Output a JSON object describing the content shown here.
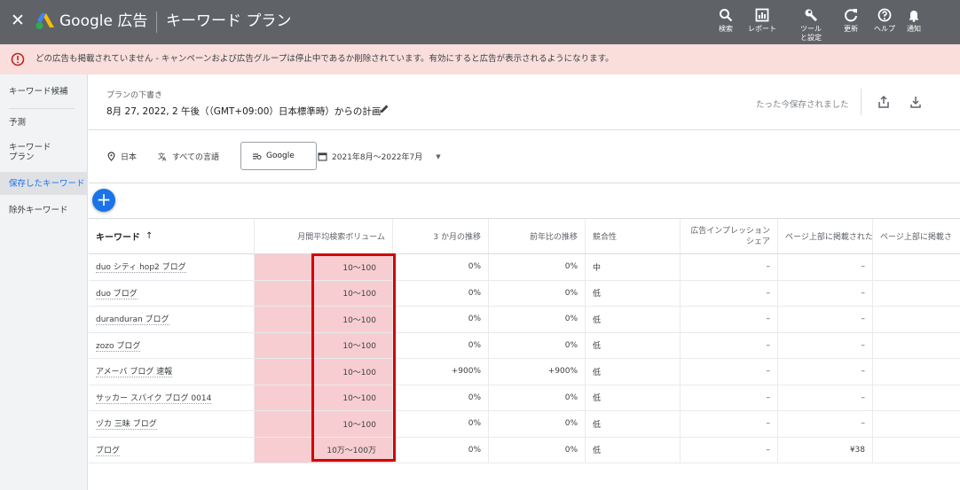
{
  "topbar": {
    "brand": "Google 広告",
    "title": "キーワード プラン",
    "items": [
      {
        "label": "検索",
        "icon": "search-icon"
      },
      {
        "label": "レポート",
        "icon": "report-icon"
      },
      {
        "label": "ツールと設定",
        "icon": "wrench-icon"
      },
      {
        "label": "更新",
        "icon": "refresh-icon"
      },
      {
        "label": "ヘルプ",
        "icon": "help-icon"
      },
      {
        "label": "通知",
        "icon": "bell-icon"
      }
    ]
  },
  "alert": {
    "text": "どの広告も掲載されていません - キャンペーンおよび広告グループは停止中であるか削除されています。有効にすると広告が表示されるようになります。"
  },
  "sidebar": {
    "items": [
      {
        "label": "キーワード候補"
      },
      {
        "label": "予測"
      },
      {
        "label": "キーワード\nプラン"
      },
      {
        "label": "保存したキーワード"
      },
      {
        "label": "除外キーワード"
      }
    ],
    "active_index": 3
  },
  "plan": {
    "label": "プランの下書き",
    "title": "8月 27, 2022, 2 午後（（GMT+09:00）日本標準時）からの計画",
    "saved": "たった今保存されました"
  },
  "filters": {
    "location": "日本",
    "language": "すべての言語",
    "network": "Google",
    "date_range": "2021年8月～2022年7月"
  },
  "table": {
    "columns": [
      "キーワード",
      "月間平均検索ボリューム",
      "3 か月の推移",
      "前年比の推移",
      "競合性",
      "広告インプレッション シェア",
      "ページ上部に掲載された",
      "ページ上部に掲載さ"
    ],
    "rows": [
      [
        "duo シティ hop2 ブログ",
        "10～100",
        "0%",
        "0%",
        "中",
        "–",
        "–",
        ""
      ],
      [
        "duo ブログ",
        "10～100",
        "0%",
        "0%",
        "低",
        "–",
        "–",
        ""
      ],
      [
        "duranduran ブログ",
        "10～100",
        "0%",
        "0%",
        "低",
        "–",
        "–",
        ""
      ],
      [
        "zozo ブログ",
        "10～100",
        "0%",
        "0%",
        "低",
        "–",
        "–",
        ""
      ],
      [
        "アメーバ ブログ 速報",
        "10～100",
        "+900%",
        "+900%",
        "低",
        "–",
        "–",
        ""
      ],
      [
        "サッカー スパイク ブログ 0014",
        "10～100",
        "0%",
        "0%",
        "低",
        "–",
        "–",
        ""
      ],
      [
        "ヅカ 三昧 ブログ",
        "10～100",
        "0%",
        "0%",
        "低",
        "–",
        "–",
        ""
      ],
      [
        "ブログ",
        "10万～100万",
        "0%",
        "0%",
        "低",
        "–",
        "¥38",
        ""
      ]
    ]
  },
  "colors": {
    "topbar": "#5f6368",
    "alert_bg": "#f9dedc",
    "accent": "#1a73e8",
    "highlight_border": "#d50000",
    "highlight_fill": "#f8cdd1"
  }
}
